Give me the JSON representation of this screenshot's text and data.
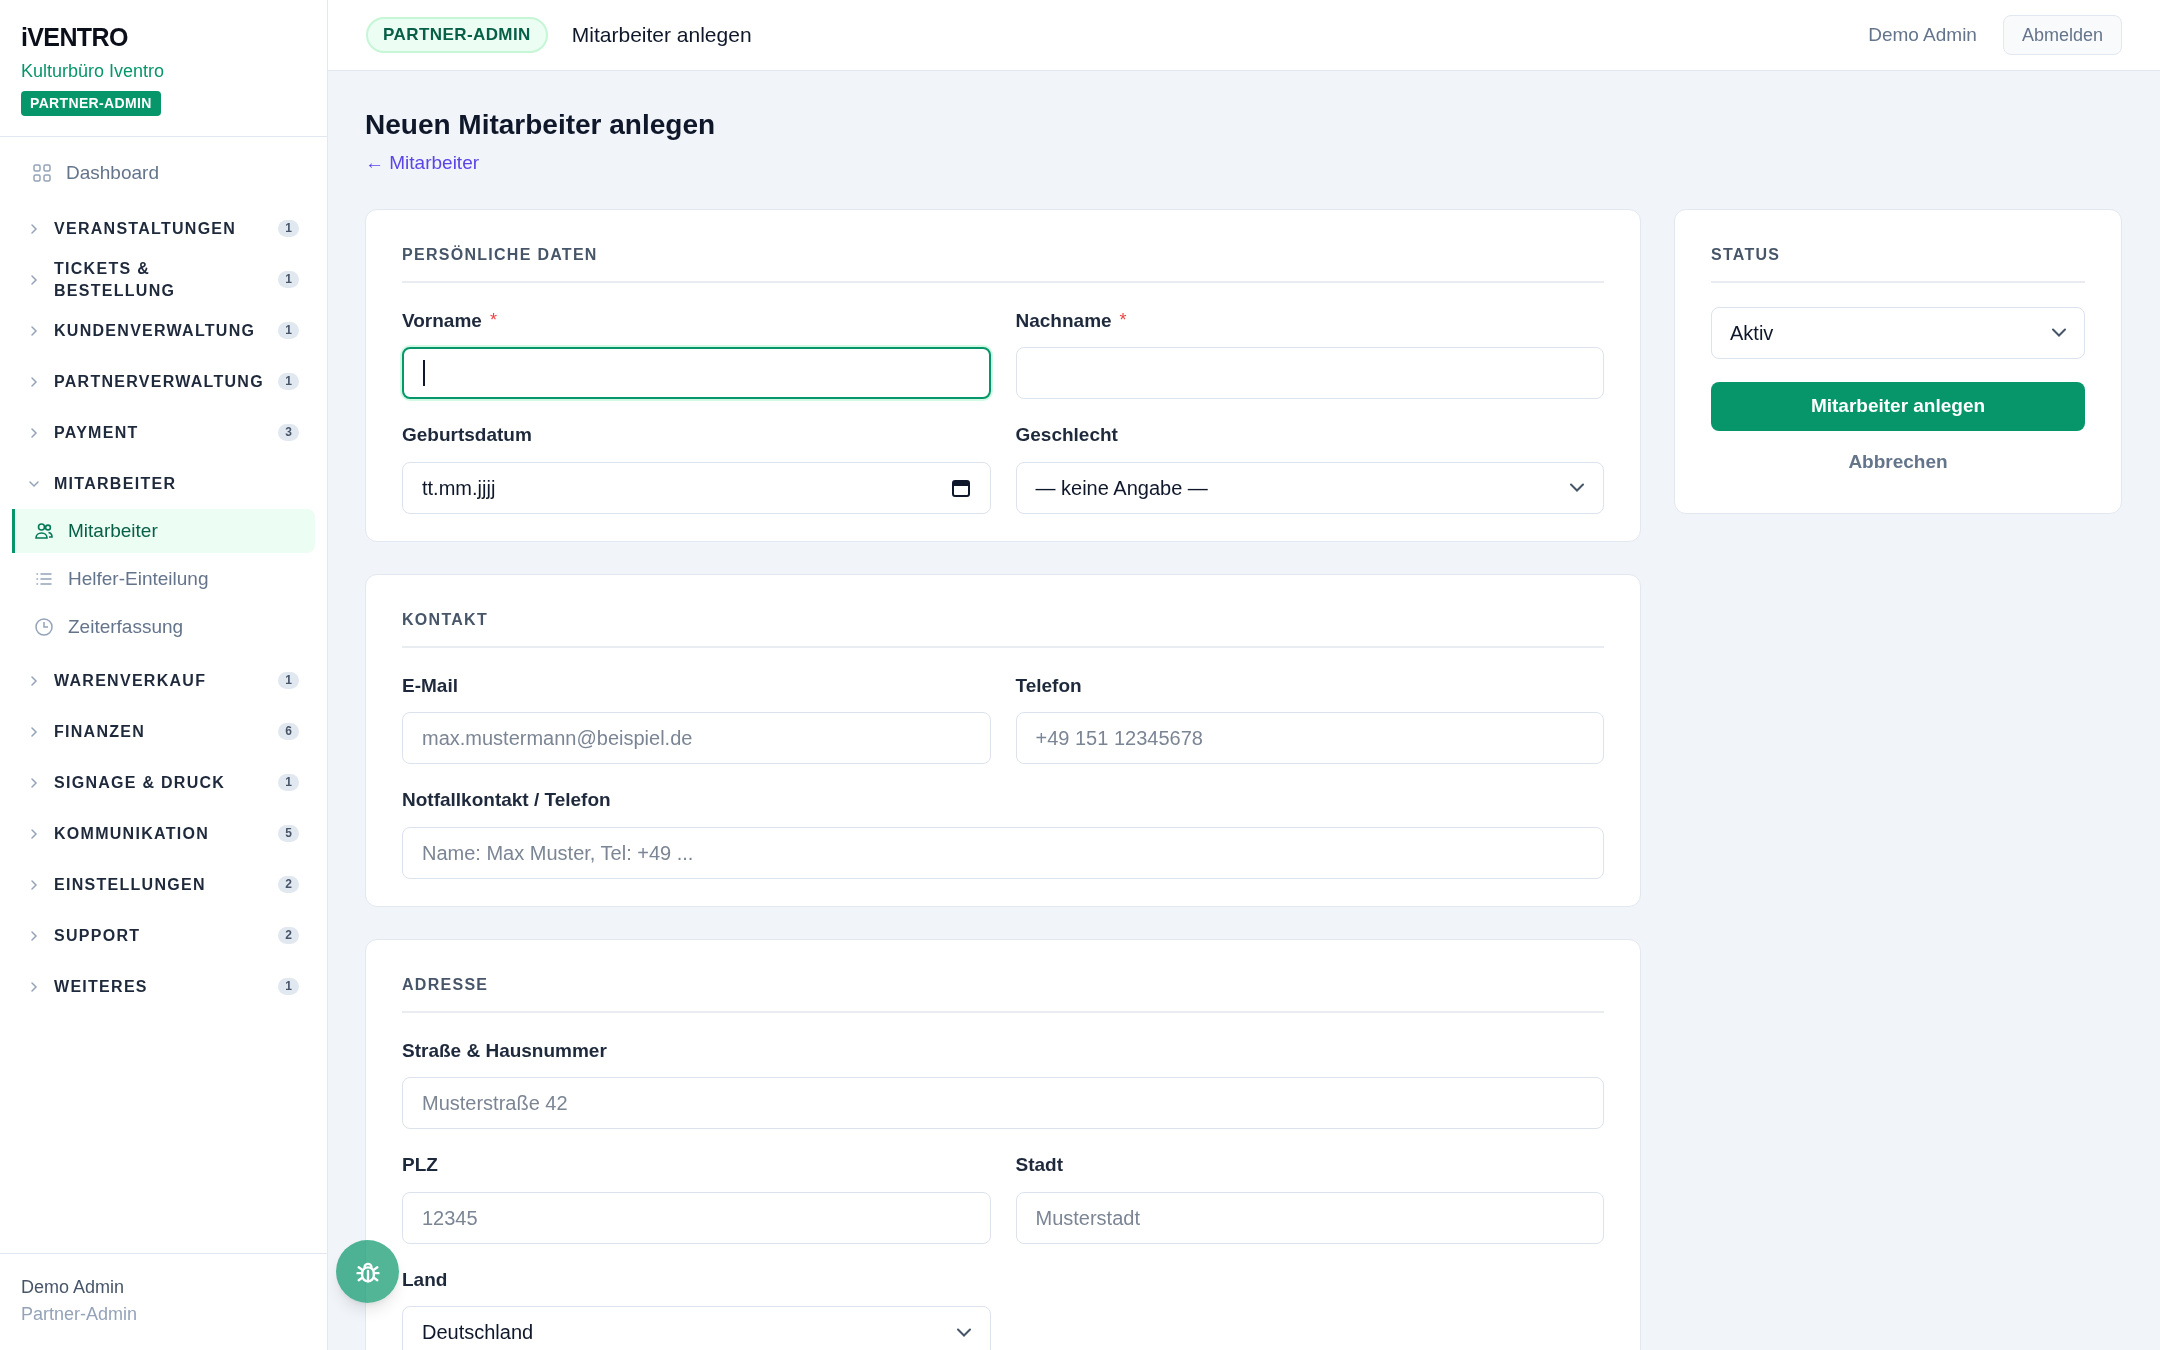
{
  "brand": {
    "logo": "iVENTRO",
    "org": "Kulturbüro Iventro",
    "role_badge": "PARTNER-ADMIN"
  },
  "sidebar": {
    "items": [
      {
        "kind": "link",
        "label": "Dashboard",
        "selected": false
      },
      {
        "kind": "group",
        "label": "VERANSTALTUNGEN",
        "count": "1",
        "expanded": false
      },
      {
        "kind": "group",
        "label": "TICKETS & BESTELLUNG",
        "count": "1",
        "expanded": false
      },
      {
        "kind": "group",
        "label": "KUNDENVERWALTUNG",
        "count": "1",
        "expanded": false
      },
      {
        "kind": "group",
        "label": "PARTNERVERWALTUNG",
        "count": "1",
        "expanded": false
      },
      {
        "kind": "group",
        "label": "PAYMENT",
        "count": "3",
        "expanded": false
      },
      {
        "kind": "group",
        "label": "MITARBEITER",
        "expanded": true,
        "children": [
          {
            "label": "Mitarbeiter",
            "selected": true
          },
          {
            "label": "Helfer-Einteilung",
            "selected": false
          },
          {
            "label": "Zeiterfassung",
            "selected": false
          }
        ]
      },
      {
        "kind": "group",
        "label": "WARENVERKAUF",
        "count": "1",
        "expanded": false
      },
      {
        "kind": "group",
        "label": "FINANZEN",
        "count": "6",
        "expanded": false
      },
      {
        "kind": "group",
        "label": "SIGNAGE & DRUCK",
        "count": "1",
        "expanded": false
      },
      {
        "kind": "group",
        "label": "KOMMUNIKATION",
        "count": "5",
        "expanded": false
      },
      {
        "kind": "group",
        "label": "EINSTELLUNGEN",
        "count": "2",
        "expanded": false
      },
      {
        "kind": "group",
        "label": "SUPPORT",
        "count": "2",
        "expanded": false
      },
      {
        "kind": "group",
        "label": "WEITERES",
        "count": "1",
        "expanded": false
      }
    ]
  },
  "sidebar_user": {
    "name": "Demo Admin",
    "role": "Partner-Admin"
  },
  "header": {
    "badge": "PARTNER-ADMIN",
    "breadcrumb": "Mitarbeiter anlegen",
    "user": "Demo Admin",
    "logout": "Abmelden"
  },
  "page": {
    "title": "Neuen Mitarbeiter anlegen",
    "back_link": "← Mitarbeiter"
  },
  "sections": [
    {
      "title": "PERSÖNLICHE DATEN",
      "fields": [
        {
          "kind": "text",
          "label": "Vorname",
          "required_mark": "*",
          "focused": true
        },
        {
          "kind": "text",
          "label": "Nachname",
          "required_mark": "*",
          "focused": false
        },
        {
          "kind": "date",
          "label": "Geburtsdatum",
          "value": "tt.mm.jjjj"
        },
        {
          "kind": "select",
          "label": "Geschlecht",
          "value": "— keine Angabe —"
        }
      ]
    },
    {
      "title": "KONTAKT",
      "fields": [
        {
          "kind": "text",
          "label": "E-Mail",
          "placeholder": "max.mustermann@beispiel.de"
        },
        {
          "kind": "text",
          "label": "Telefon",
          "placeholder": "+49 151 12345678"
        },
        {
          "kind": "text",
          "label": "Notfallkontakt / Telefon",
          "placeholder": "Name: Max Muster, Tel: +49 ...",
          "wide": true
        }
      ]
    },
    {
      "title": "ADRESSE",
      "fields": [
        {
          "kind": "text",
          "label": "Straße & Hausnummer",
          "placeholder": "Musterstraße 42",
          "wide": true
        },
        {
          "kind": "text",
          "label": "PLZ",
          "placeholder": "12345"
        },
        {
          "kind": "text",
          "label": "Stadt",
          "placeholder": "Musterstadt"
        },
        {
          "kind": "select",
          "label": "Land",
          "value": "Deutschland"
        }
      ]
    }
  ],
  "status": {
    "title": "STATUS",
    "value": "Aktiv",
    "submit": "Mitarbeiter anlegen",
    "cancel": "Abbrechen"
  }
}
